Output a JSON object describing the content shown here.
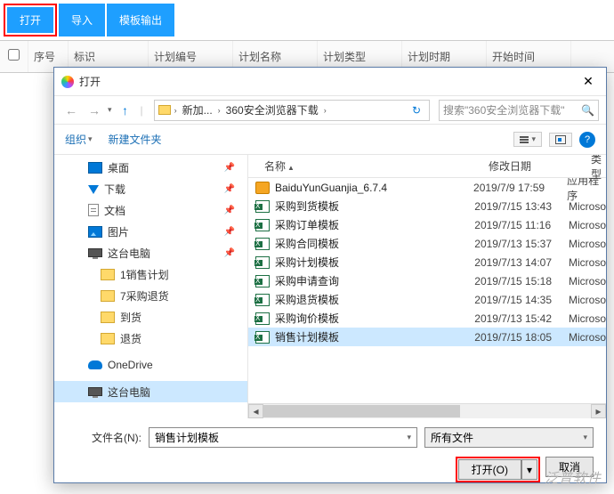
{
  "toolbar": {
    "open": "打开",
    "import": "导入",
    "export": "模板输出"
  },
  "columns": {
    "seq": "序号",
    "mark": "标识",
    "code": "计划编号",
    "name": "计划名称",
    "type": "计划类型",
    "period": "计划时期",
    "start": "开始时间"
  },
  "dialog": {
    "title": "打开",
    "breadcrumb": {
      "seg1": "新加...",
      "seg2": "360安全浏览器下载"
    },
    "searchPlaceholder": "搜索\"360安全浏览器下载\"",
    "organize": "组织",
    "newFolder": "新建文件夹",
    "headers": {
      "name": "名称",
      "date": "修改日期",
      "type": "类型"
    },
    "sidebar": [
      {
        "icon": "desktop",
        "label": "桌面",
        "pin": true
      },
      {
        "icon": "down",
        "label": "下载",
        "pin": true
      },
      {
        "icon": "doc",
        "label": "文档",
        "pin": true
      },
      {
        "icon": "pic",
        "label": "图片",
        "pin": true
      },
      {
        "icon": "pc",
        "label": "这台电脑",
        "pin": true
      },
      {
        "icon": "folder",
        "label": "1销售计划",
        "indent": true
      },
      {
        "icon": "folder",
        "label": "7采购退货",
        "indent": true
      },
      {
        "icon": "folder",
        "label": "到货",
        "indent": true
      },
      {
        "icon": "folder",
        "label": "退货",
        "indent": true
      },
      {
        "icon": "gap"
      },
      {
        "icon": "cloud",
        "label": "OneDrive"
      },
      {
        "icon": "gap"
      },
      {
        "icon": "pc",
        "label": "这台电脑",
        "sel": true
      }
    ],
    "files": [
      {
        "icon": "app",
        "name": "BaiduYunGuanjia_6.7.4",
        "date": "2019/7/9 17:59",
        "type": "应用程序"
      },
      {
        "icon": "xls",
        "name": "采购到货模板",
        "date": "2019/7/15 13:43",
        "type": "Microso"
      },
      {
        "icon": "xls",
        "name": "采购订单模板",
        "date": "2019/7/15 11:16",
        "type": "Microso"
      },
      {
        "icon": "xls",
        "name": "采购合同模板",
        "date": "2019/7/13 15:37",
        "type": "Microso"
      },
      {
        "icon": "xls",
        "name": "采购计划模板",
        "date": "2019/7/13 14:07",
        "type": "Microso"
      },
      {
        "icon": "xls",
        "name": "采购申请查询",
        "date": "2019/7/15 15:18",
        "type": "Microso"
      },
      {
        "icon": "xls",
        "name": "采购退货模板",
        "date": "2019/7/15 14:35",
        "type": "Microso"
      },
      {
        "icon": "xls",
        "name": "采购询价模板",
        "date": "2019/7/13 15:42",
        "type": "Microso"
      },
      {
        "icon": "xls",
        "name": "销售计划模板",
        "date": "2019/7/15 18:05",
        "type": "Microso",
        "sel": true
      }
    ],
    "filenameLabel": "文件名(N):",
    "filenameValue": "销售计划模板",
    "filterValue": "所有文件",
    "openBtn": "打开(O)",
    "cancelBtn": "取消"
  },
  "watermark": "泛普软件"
}
